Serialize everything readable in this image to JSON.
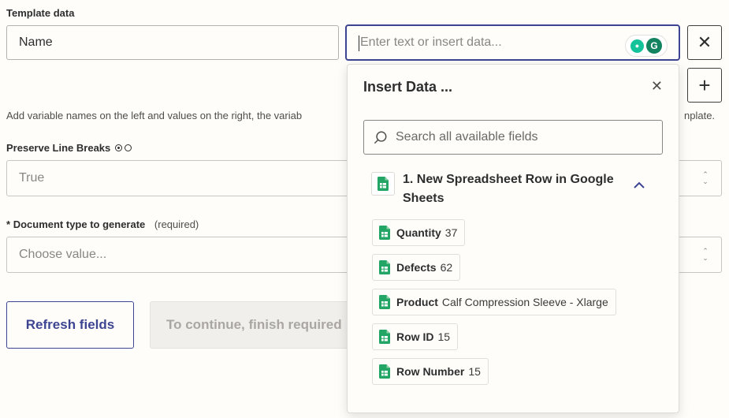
{
  "template": {
    "label": "Template data",
    "name_value": "Name",
    "value_placeholder": "Enter text or insert data...",
    "help_left": "Add variable names on the left and values on the right, the variab",
    "help_right": "nplate."
  },
  "preserve_line_breaks": {
    "label": "Preserve Line Breaks",
    "value": "True"
  },
  "document_type": {
    "asterisk": "*",
    "label": "Document type to generate",
    "required": "(required)",
    "placeholder": "Choose value..."
  },
  "buttons": {
    "refresh": "Refresh fields",
    "continue": "To continue, finish required"
  },
  "insert_data": {
    "title": "Insert Data ...",
    "search_placeholder": "Search all available fields",
    "section_title": "1. New Spreadsheet Row in Google Sheets",
    "fields": [
      {
        "key": "Quantity",
        "value": "37"
      },
      {
        "key": "Defects",
        "value": "62"
      },
      {
        "key": "Product",
        "value": "Calf Compression Sleeve - Xlarge"
      },
      {
        "key": "Row ID",
        "value": "15"
      },
      {
        "key": "Row Number",
        "value": "15"
      }
    ]
  },
  "colors": {
    "accent": "#3d4592",
    "sheets_green": "#23a566"
  },
  "icons": {
    "close": "close-icon",
    "plus": "plus-icon",
    "search": "search-icon",
    "chevron": "chevron-up-icon",
    "sheets": "google-sheets-icon"
  }
}
